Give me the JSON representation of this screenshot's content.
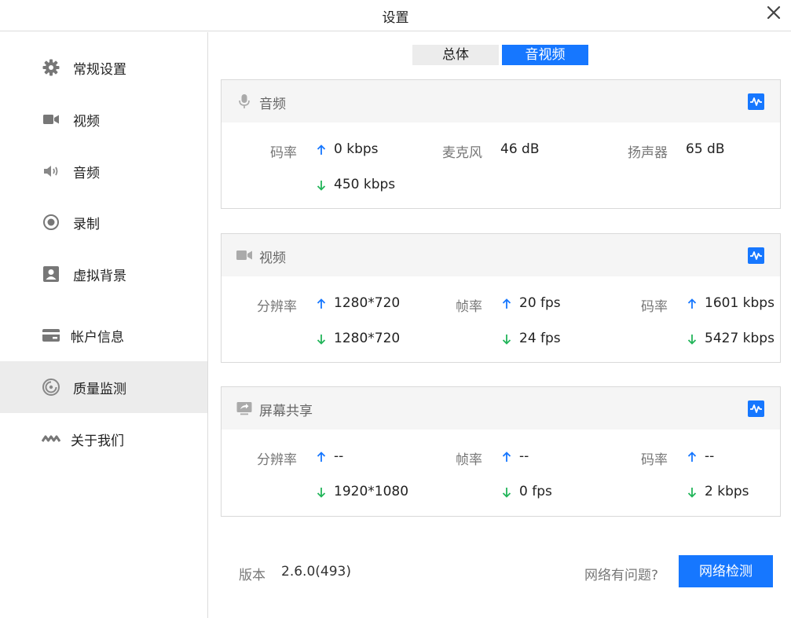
{
  "window": {
    "title": "设置"
  },
  "sidebar": {
    "items": [
      {
        "label": "常规设置",
        "icon": "gear-icon"
      },
      {
        "label": "视频",
        "icon": "video-camera-icon"
      },
      {
        "label": "音频",
        "icon": "speaker-icon"
      },
      {
        "label": "录制",
        "icon": "record-icon"
      },
      {
        "label": "虚拟背景",
        "icon": "portrait-icon"
      },
      {
        "label": "帐户信息",
        "icon": "card-icon"
      },
      {
        "label": "质量监测",
        "icon": "gauge-icon",
        "active": true
      },
      {
        "label": "关于我们",
        "icon": "logo-icon"
      }
    ]
  },
  "tabs": {
    "general": "总体",
    "av": "音视频",
    "selected": "音视频"
  },
  "audio": {
    "title": "音频",
    "bitrate_label": "码率",
    "bitrate_up": "0 kbps",
    "bitrate_down": "450 kbps",
    "mic_label": "麦克风",
    "mic_value": "46 dB",
    "speaker_label": "扬声器",
    "speaker_value": "65 dB"
  },
  "video": {
    "title": "视频",
    "resolution_label": "分辨率",
    "resolution_up": "1280*720",
    "resolution_down": "1280*720",
    "fps_label": "帧率",
    "fps_up": "20 fps",
    "fps_down": "24 fps",
    "bitrate_label": "码率",
    "bitrate_up": "1601 kbps",
    "bitrate_down": "5427 kbps"
  },
  "screen": {
    "title": "屏幕共享",
    "resolution_label": "分辨率",
    "resolution_up": "--",
    "resolution_down": "1920*1080",
    "fps_label": "帧率",
    "fps_up": "--",
    "fps_down": "0 fps",
    "bitrate_label": "码率",
    "bitrate_up": "--",
    "bitrate_down": "2 kbps"
  },
  "footer": {
    "version_label": "版本",
    "version_value": "2.6.0(493)",
    "network_question": "网络有问题?",
    "network_button": "网络检测"
  },
  "colors": {
    "accent": "#1677ff",
    "up_arrow": "#1677ff",
    "down_arrow": "#22b55a",
    "active_nav": "#ececec"
  }
}
